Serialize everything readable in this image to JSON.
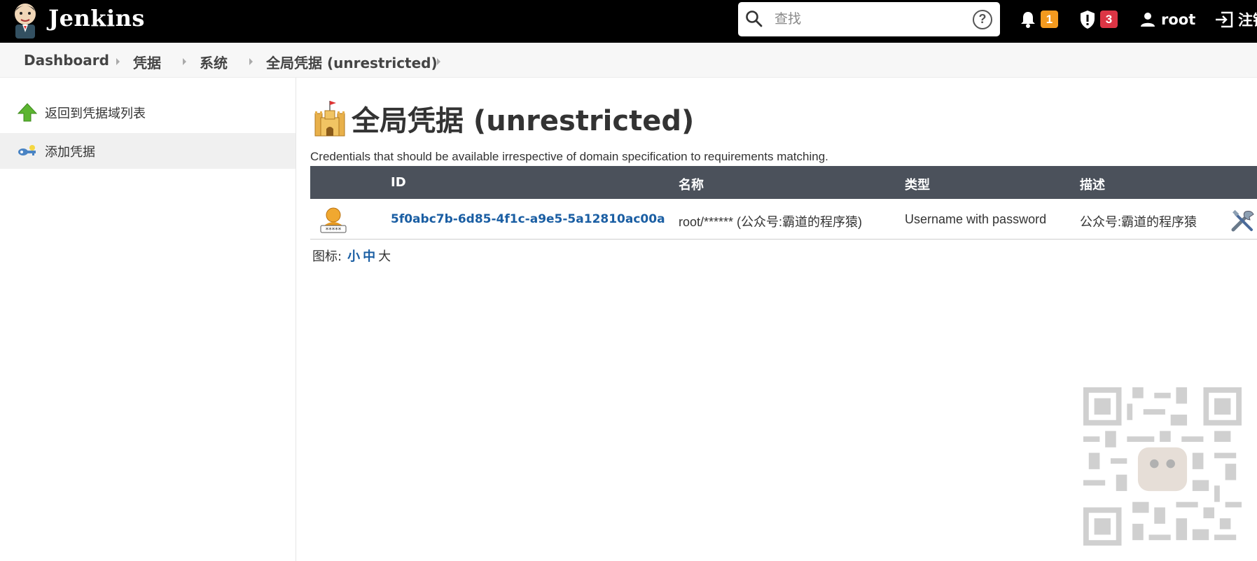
{
  "header": {
    "brand": "Jenkins",
    "search_placeholder": "查找",
    "help_label": "?",
    "notifications_count": "1",
    "security_count": "3",
    "user": "root",
    "logout_label": "注销"
  },
  "breadcrumb": [
    "Dashboard",
    "凭据",
    "系统",
    "全局凭据 (unrestricted)"
  ],
  "sidebar": {
    "items": [
      {
        "label": "返回到凭据域列表",
        "icon": "up-arrow-icon"
      },
      {
        "label": "添加凭据",
        "icon": "key-icon"
      }
    ]
  },
  "main": {
    "title": "全局凭据 (unrestricted)",
    "description": "Credentials that should be available irrespective of domain specification to requirements matching.",
    "table": {
      "headers": [
        "ID",
        "名称",
        "类型",
        "描述"
      ],
      "rows": [
        {
          "id": "5f0abc7b-6d85-4f1c-a9e5-5a12810ac00a",
          "name": "root/****** (公众号:霸道的程序猿)",
          "type": "Username with password",
          "description": "公众号:霸道的程序猿"
        }
      ]
    },
    "icon_size_label": "图标:",
    "icon_sizes": [
      "小",
      "中",
      "大"
    ]
  },
  "colors": {
    "header_bg": "#000000",
    "table_header_bg": "#4b515b",
    "link": "#1a5ea3",
    "badge_orange": "#f39a1f",
    "badge_red": "#dc3545"
  }
}
